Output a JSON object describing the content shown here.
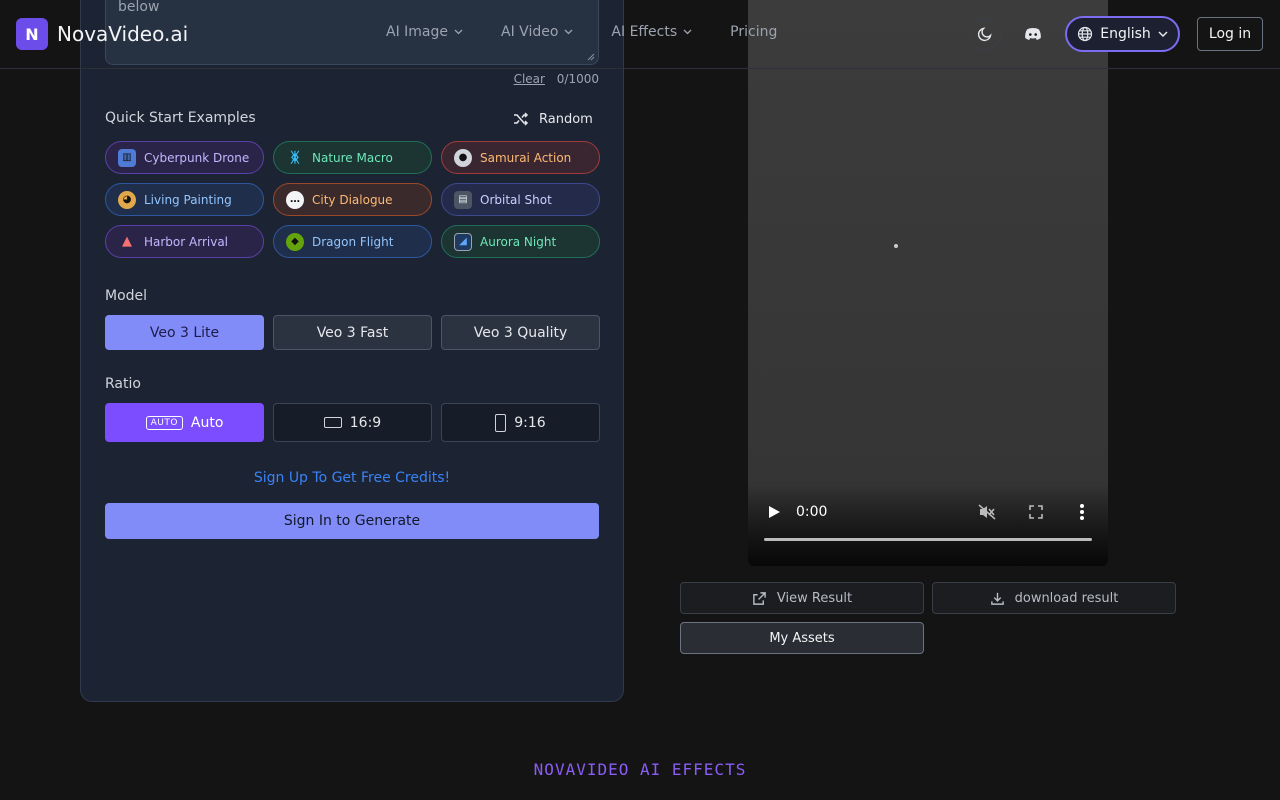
{
  "header": {
    "logo_letter": "N",
    "brand": "NovaVideo.ai",
    "nav": [
      "AI Image",
      "AI Video",
      "AI Effects",
      "Pricing"
    ],
    "language": "English",
    "login": "Log in"
  },
  "prompt": {
    "text": "below",
    "clear": "Clear",
    "count": "0/1000"
  },
  "examples": {
    "title": "Quick Start Examples",
    "random": "Random",
    "items": [
      {
        "label": "Cyberpunk Drone",
        "icon": "cityscape-icon"
      },
      {
        "label": "Nature Macro",
        "icon": "butterfly-icon"
      },
      {
        "label": "Samurai Action",
        "icon": "samurai-icon"
      },
      {
        "label": "Living Painting",
        "icon": "palette-icon"
      },
      {
        "label": "City Dialogue",
        "icon": "speech-bubble-icon"
      },
      {
        "label": "Orbital Shot",
        "icon": "clapper-icon"
      },
      {
        "label": "Harbor Arrival",
        "icon": "sailboat-icon"
      },
      {
        "label": "Dragon Flight",
        "icon": "dragon-icon"
      },
      {
        "label": "Aurora Night",
        "icon": "night-landscape-icon"
      }
    ]
  },
  "model": {
    "title": "Model",
    "options": [
      "Veo 3 Lite",
      "Veo 3 Fast",
      "Veo 3 Quality"
    ],
    "selected": "Veo 3 Lite"
  },
  "ratio": {
    "title": "Ratio",
    "auto_badge": "AUTO",
    "options": [
      "Auto",
      "16:9",
      "9:16"
    ],
    "selected": "Auto"
  },
  "signup_link": "Sign Up To Get Free Credits!",
  "generate_button": "Sign In to Generate",
  "video": {
    "time": "0:00"
  },
  "result": {
    "view": "View Result",
    "download": "download result",
    "assets": "My Assets"
  },
  "effects_title": "NOVAVIDEO AI EFFECTS",
  "colors": {
    "accent": "#818cf8",
    "ratio_active": "#7c4dff",
    "brand": "#6d4dea",
    "link": "#3b82f6"
  }
}
